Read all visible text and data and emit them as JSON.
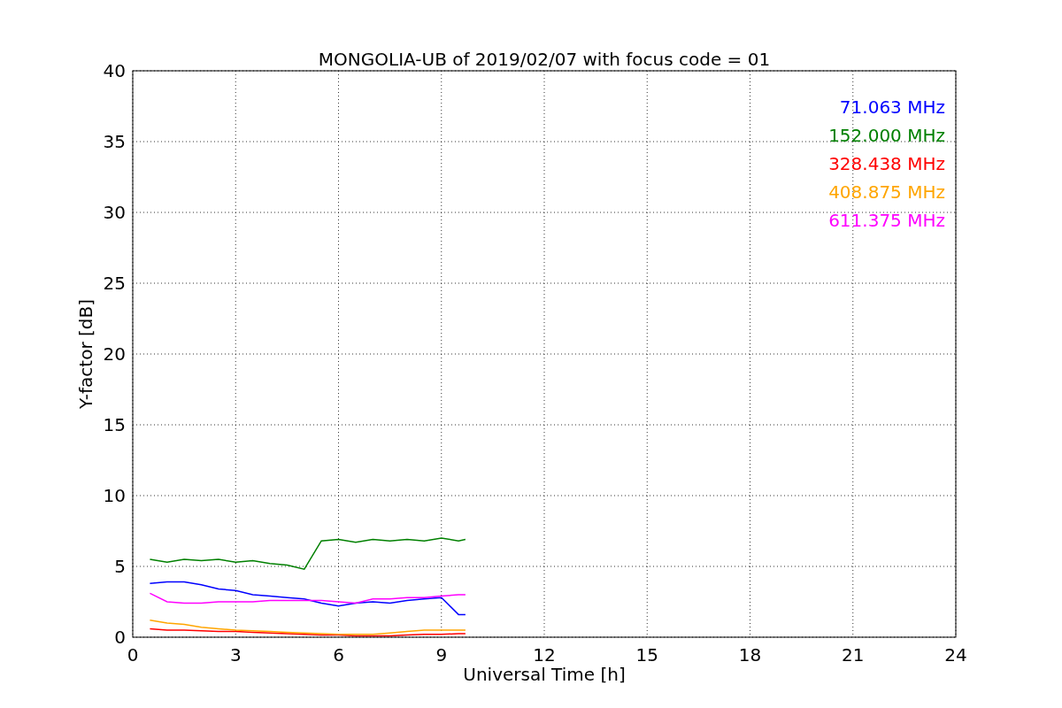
{
  "chart_data": {
    "type": "line",
    "title": "MONGOLIA-UB of 2019/02/07 with focus code = 01",
    "xlabel": "Universal Time [h]",
    "ylabel": "Y-factor [dB]",
    "x": [
      0.5,
      1,
      1.5,
      2,
      2.5,
      3,
      3.5,
      4,
      4.5,
      5,
      5.5,
      6,
      6.5,
      7,
      7.5,
      8,
      8.5,
      9,
      9.5,
      9.7
    ],
    "series": [
      {
        "name": "71.063 MHz",
        "color": "#0000ff",
        "values": [
          3.8,
          3.9,
          3.9,
          3.7,
          3.4,
          3.3,
          3.0,
          2.9,
          2.8,
          2.7,
          2.4,
          2.2,
          2.4,
          2.5,
          2.4,
          2.6,
          2.7,
          2.8,
          1.6,
          1.6
        ]
      },
      {
        "name": "152.000 MHz",
        "color": "#008000",
        "values": [
          5.5,
          5.3,
          5.5,
          5.4,
          5.5,
          5.3,
          5.4,
          5.2,
          5.1,
          4.8,
          6.8,
          6.9,
          6.7,
          6.9,
          6.8,
          6.9,
          6.8,
          7.0,
          6.8,
          6.9
        ]
      },
      {
        "name": "328.438 MHz",
        "color": "#ff0000",
        "values": [
          0.6,
          0.5,
          0.5,
          0.45,
          0.4,
          0.4,
          0.35,
          0.3,
          0.25,
          0.2,
          0.15,
          0.15,
          0.1,
          0.1,
          0.1,
          0.15,
          0.2,
          0.2,
          0.25,
          0.25
        ]
      },
      {
        "name": "408.875 MHz",
        "color": "#ffa500",
        "values": [
          1.2,
          1.0,
          0.9,
          0.7,
          0.6,
          0.5,
          0.45,
          0.4,
          0.35,
          0.3,
          0.25,
          0.2,
          0.2,
          0.2,
          0.3,
          0.4,
          0.5,
          0.5,
          0.5,
          0.5
        ]
      },
      {
        "name": "611.375 MHz",
        "color": "#ff00ff",
        "values": [
          3.1,
          2.5,
          2.4,
          2.4,
          2.5,
          2.5,
          2.5,
          2.6,
          2.6,
          2.6,
          2.6,
          2.5,
          2.4,
          2.7,
          2.7,
          2.8,
          2.8,
          2.9,
          3.0,
          3.0
        ]
      }
    ],
    "xlim": [
      0,
      24
    ],
    "ylim": [
      0,
      40
    ],
    "xticks": [
      0,
      3,
      6,
      9,
      12,
      15,
      18,
      21,
      24
    ],
    "yticks": [
      0,
      5,
      10,
      15,
      20,
      25,
      30,
      35,
      40
    ],
    "grid": true
  }
}
